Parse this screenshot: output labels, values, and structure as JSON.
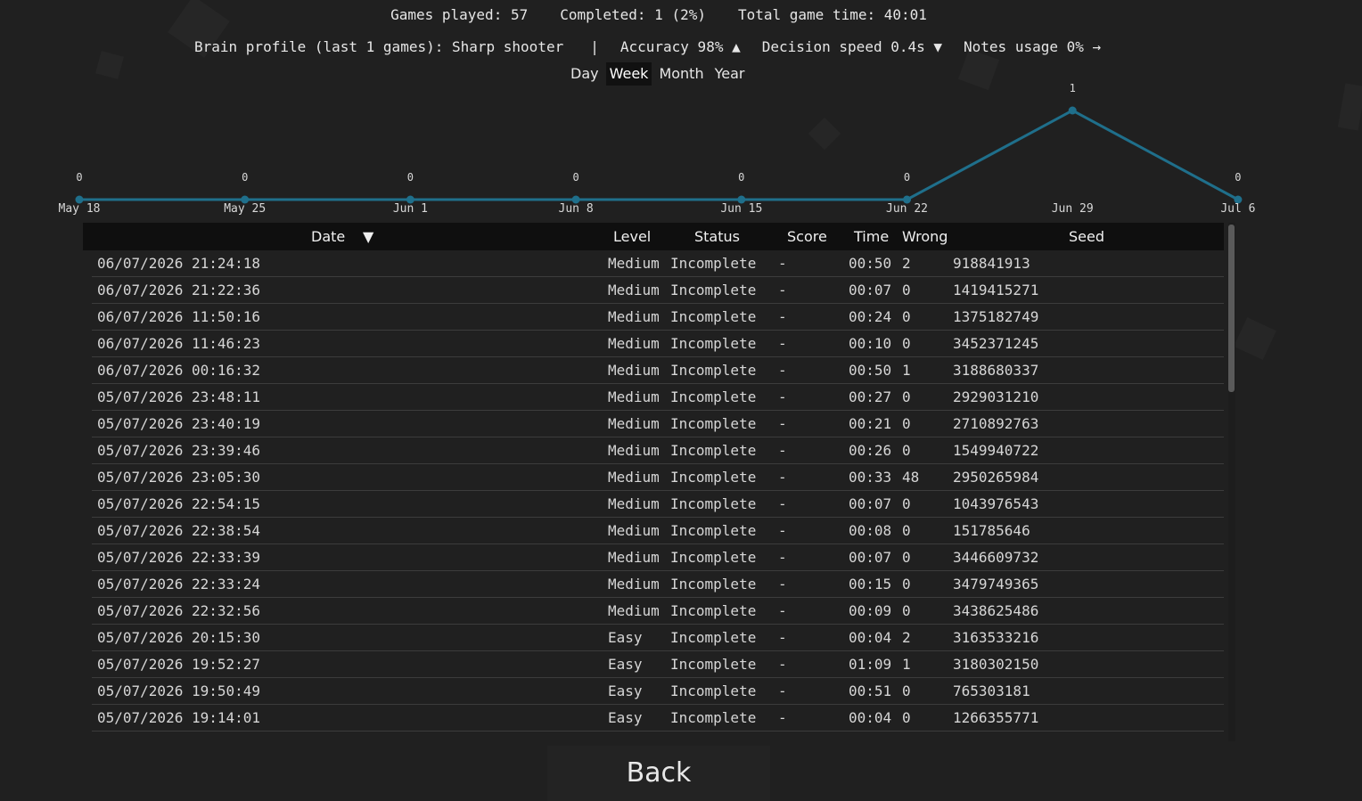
{
  "stats": {
    "games_played": "Games played: 57",
    "completed": "Completed: 1 (2%)",
    "total_time": "Total game time: 40:01"
  },
  "profile": {
    "label": "Brain profile (last 1 games): Sharp shooter",
    "separator": "|",
    "accuracy": "Accuracy 98% ▲",
    "decision_speed": "Decision speed 0.4s ▼",
    "notes_usage": "Notes usage 0% →"
  },
  "tabs": [
    {
      "label": "Day",
      "active": false
    },
    {
      "label": "Week",
      "active": true
    },
    {
      "label": "Month",
      "active": false
    },
    {
      "label": "Year",
      "active": false
    }
  ],
  "chart_data": {
    "type": "line",
    "categories": [
      "May 18",
      "May 25",
      "Jun 1",
      "Jun 8",
      "Jun 15",
      "Jun 22",
      "Jun 29",
      "Jul 6"
    ],
    "values": [
      0,
      0,
      0,
      0,
      0,
      0,
      1,
      0
    ],
    "ylim": [
      0,
      1
    ],
    "color": "#1f6f8b",
    "grid": false
  },
  "table": {
    "headers": {
      "date": "Date",
      "sort_indicator": "▼",
      "level": "Level",
      "status": "Status",
      "score": "Score",
      "time": "Time",
      "wrong": "Wrong",
      "seed": "Seed"
    },
    "rows": [
      {
        "date": "06/07/2026 21:24:18",
        "level": "Medium",
        "status": "Incomplete",
        "score": "-",
        "time": "00:50",
        "wrong": "2",
        "seed": "918841913"
      },
      {
        "date": "06/07/2026 21:22:36",
        "level": "Medium",
        "status": "Incomplete",
        "score": "-",
        "time": "00:07",
        "wrong": "0",
        "seed": "1419415271"
      },
      {
        "date": "06/07/2026 11:50:16",
        "level": "Medium",
        "status": "Incomplete",
        "score": "-",
        "time": "00:24",
        "wrong": "0",
        "seed": "1375182749"
      },
      {
        "date": "06/07/2026 11:46:23",
        "level": "Medium",
        "status": "Incomplete",
        "score": "-",
        "time": "00:10",
        "wrong": "0",
        "seed": "3452371245"
      },
      {
        "date": "06/07/2026 00:16:32",
        "level": "Medium",
        "status": "Incomplete",
        "score": "-",
        "time": "00:50",
        "wrong": "1",
        "seed": "3188680337"
      },
      {
        "date": "05/07/2026 23:48:11",
        "level": "Medium",
        "status": "Incomplete",
        "score": "-",
        "time": "00:27",
        "wrong": "0",
        "seed": "2929031210"
      },
      {
        "date": "05/07/2026 23:40:19",
        "level": "Medium",
        "status": "Incomplete",
        "score": "-",
        "time": "00:21",
        "wrong": "0",
        "seed": "2710892763"
      },
      {
        "date": "05/07/2026 23:39:46",
        "level": "Medium",
        "status": "Incomplete",
        "score": "-",
        "time": "00:26",
        "wrong": "0",
        "seed": "1549940722"
      },
      {
        "date": "05/07/2026 23:05:30",
        "level": "Medium",
        "status": "Incomplete",
        "score": "-",
        "time": "00:33",
        "wrong": "48",
        "seed": "2950265984"
      },
      {
        "date": "05/07/2026 22:54:15",
        "level": "Medium",
        "status": "Incomplete",
        "score": "-",
        "time": "00:07",
        "wrong": "0",
        "seed": "1043976543"
      },
      {
        "date": "05/07/2026 22:38:54",
        "level": "Medium",
        "status": "Incomplete",
        "score": "-",
        "time": "00:08",
        "wrong": "0",
        "seed": "151785646"
      },
      {
        "date": "05/07/2026 22:33:39",
        "level": "Medium",
        "status": "Incomplete",
        "score": "-",
        "time": "00:07",
        "wrong": "0",
        "seed": "3446609732"
      },
      {
        "date": "05/07/2026 22:33:24",
        "level": "Medium",
        "status": "Incomplete",
        "score": "-",
        "time": "00:15",
        "wrong": "0",
        "seed": "3479749365"
      },
      {
        "date": "05/07/2026 22:32:56",
        "level": "Medium",
        "status": "Incomplete",
        "score": "-",
        "time": "00:09",
        "wrong": "0",
        "seed": "3438625486"
      },
      {
        "date": "05/07/2026 20:15:30",
        "level": "Easy",
        "status": "Incomplete",
        "score": "-",
        "time": "00:04",
        "wrong": "2",
        "seed": "3163533216"
      },
      {
        "date": "05/07/2026 19:52:27",
        "level": "Easy",
        "status": "Incomplete",
        "score": "-",
        "time": "01:09",
        "wrong": "1",
        "seed": "3180302150"
      },
      {
        "date": "05/07/2026 19:50:49",
        "level": "Easy",
        "status": "Incomplete",
        "score": "-",
        "time": "00:51",
        "wrong": "0",
        "seed": "765303181"
      },
      {
        "date": "05/07/2026 19:14:01",
        "level": "Easy",
        "status": "Incomplete",
        "score": "-",
        "time": "00:04",
        "wrong": "0",
        "seed": "1266355771"
      }
    ]
  },
  "back_button": "Back"
}
